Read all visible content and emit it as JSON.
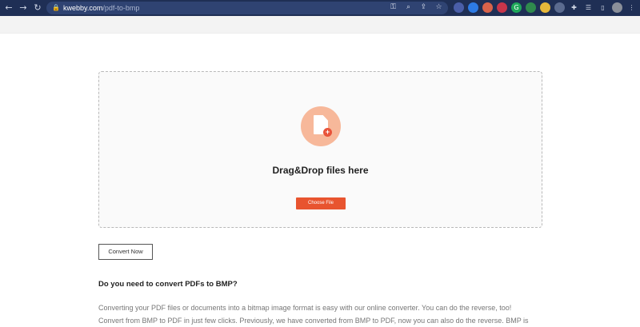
{
  "browser": {
    "url_domain": "kwebby.com",
    "url_path": "/pdf-to-bmp",
    "back_icon": "arrow-left-icon",
    "forward_icon": "arrow-right-icon",
    "reload_icon": "reload-icon"
  },
  "upload": {
    "title": "Drag&Drop files here",
    "choose_label": "Choose File",
    "accent_color": "#e8542f"
  },
  "actions": {
    "convert_label": "Convert Now"
  },
  "content": {
    "question": "Do you need to convert PDFs to BMP?",
    "line1": "Converting your PDF files or documents into a bitmap image format is easy with our online converter. You can do the reverse, too!",
    "line2": "Convert from BMP to PDF in just few clicks. Previously, we have converted from BMP to PDF, now you can also do the reverse. BMP is"
  }
}
